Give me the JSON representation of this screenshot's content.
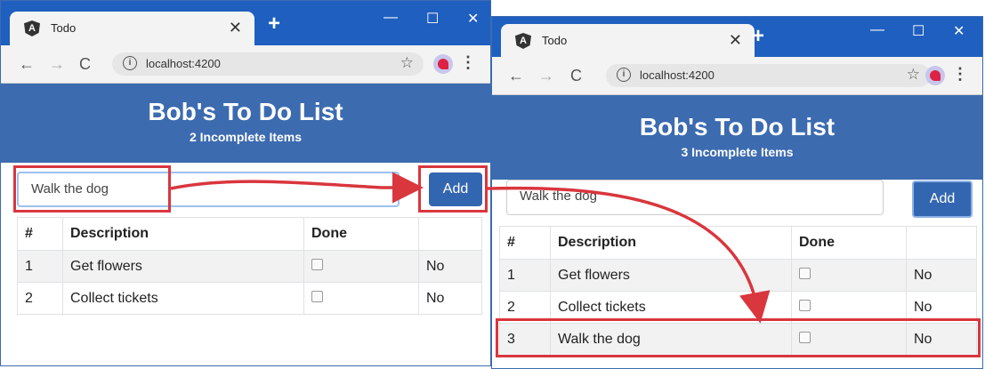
{
  "window_left": {
    "tab_title": "Todo",
    "url": "localhost:4200",
    "header_title": "Bob's To Do List",
    "header_subtitle": "2 Incomplete Items",
    "input_value": "Walk the dog",
    "add_label": "Add",
    "columns": [
      "#",
      "Description",
      "Done",
      ""
    ],
    "rows": [
      {
        "num": "1",
        "desc": "Get flowers",
        "done": "No"
      },
      {
        "num": "2",
        "desc": "Collect tickets",
        "done": "No"
      }
    ]
  },
  "window_right": {
    "tab_title": "Todo",
    "url": "localhost:4200",
    "header_title": "Bob's To Do List",
    "header_subtitle": "3 Incomplete Items",
    "input_value": "Walk the dog",
    "add_label": "Add",
    "columns": [
      "#",
      "Description",
      "Done",
      ""
    ],
    "rows": [
      {
        "num": "1",
        "desc": "Get flowers",
        "done": "No"
      },
      {
        "num": "2",
        "desc": "Collect tickets",
        "done": "No"
      },
      {
        "num": "3",
        "desc": "Walk the dog",
        "done": "No"
      }
    ]
  },
  "colors": {
    "titlebar": "#1f5fbf",
    "header": "#3c6bb0",
    "add_button": "#3366b0",
    "annotation": "#d9363e"
  },
  "icons": [
    "angular-icon",
    "close-icon",
    "plus-icon",
    "minimize-icon",
    "maximize-icon",
    "back-icon",
    "forward-icon",
    "reload-icon",
    "info-icon",
    "star-icon",
    "avatar-icon",
    "menu-icon"
  ]
}
